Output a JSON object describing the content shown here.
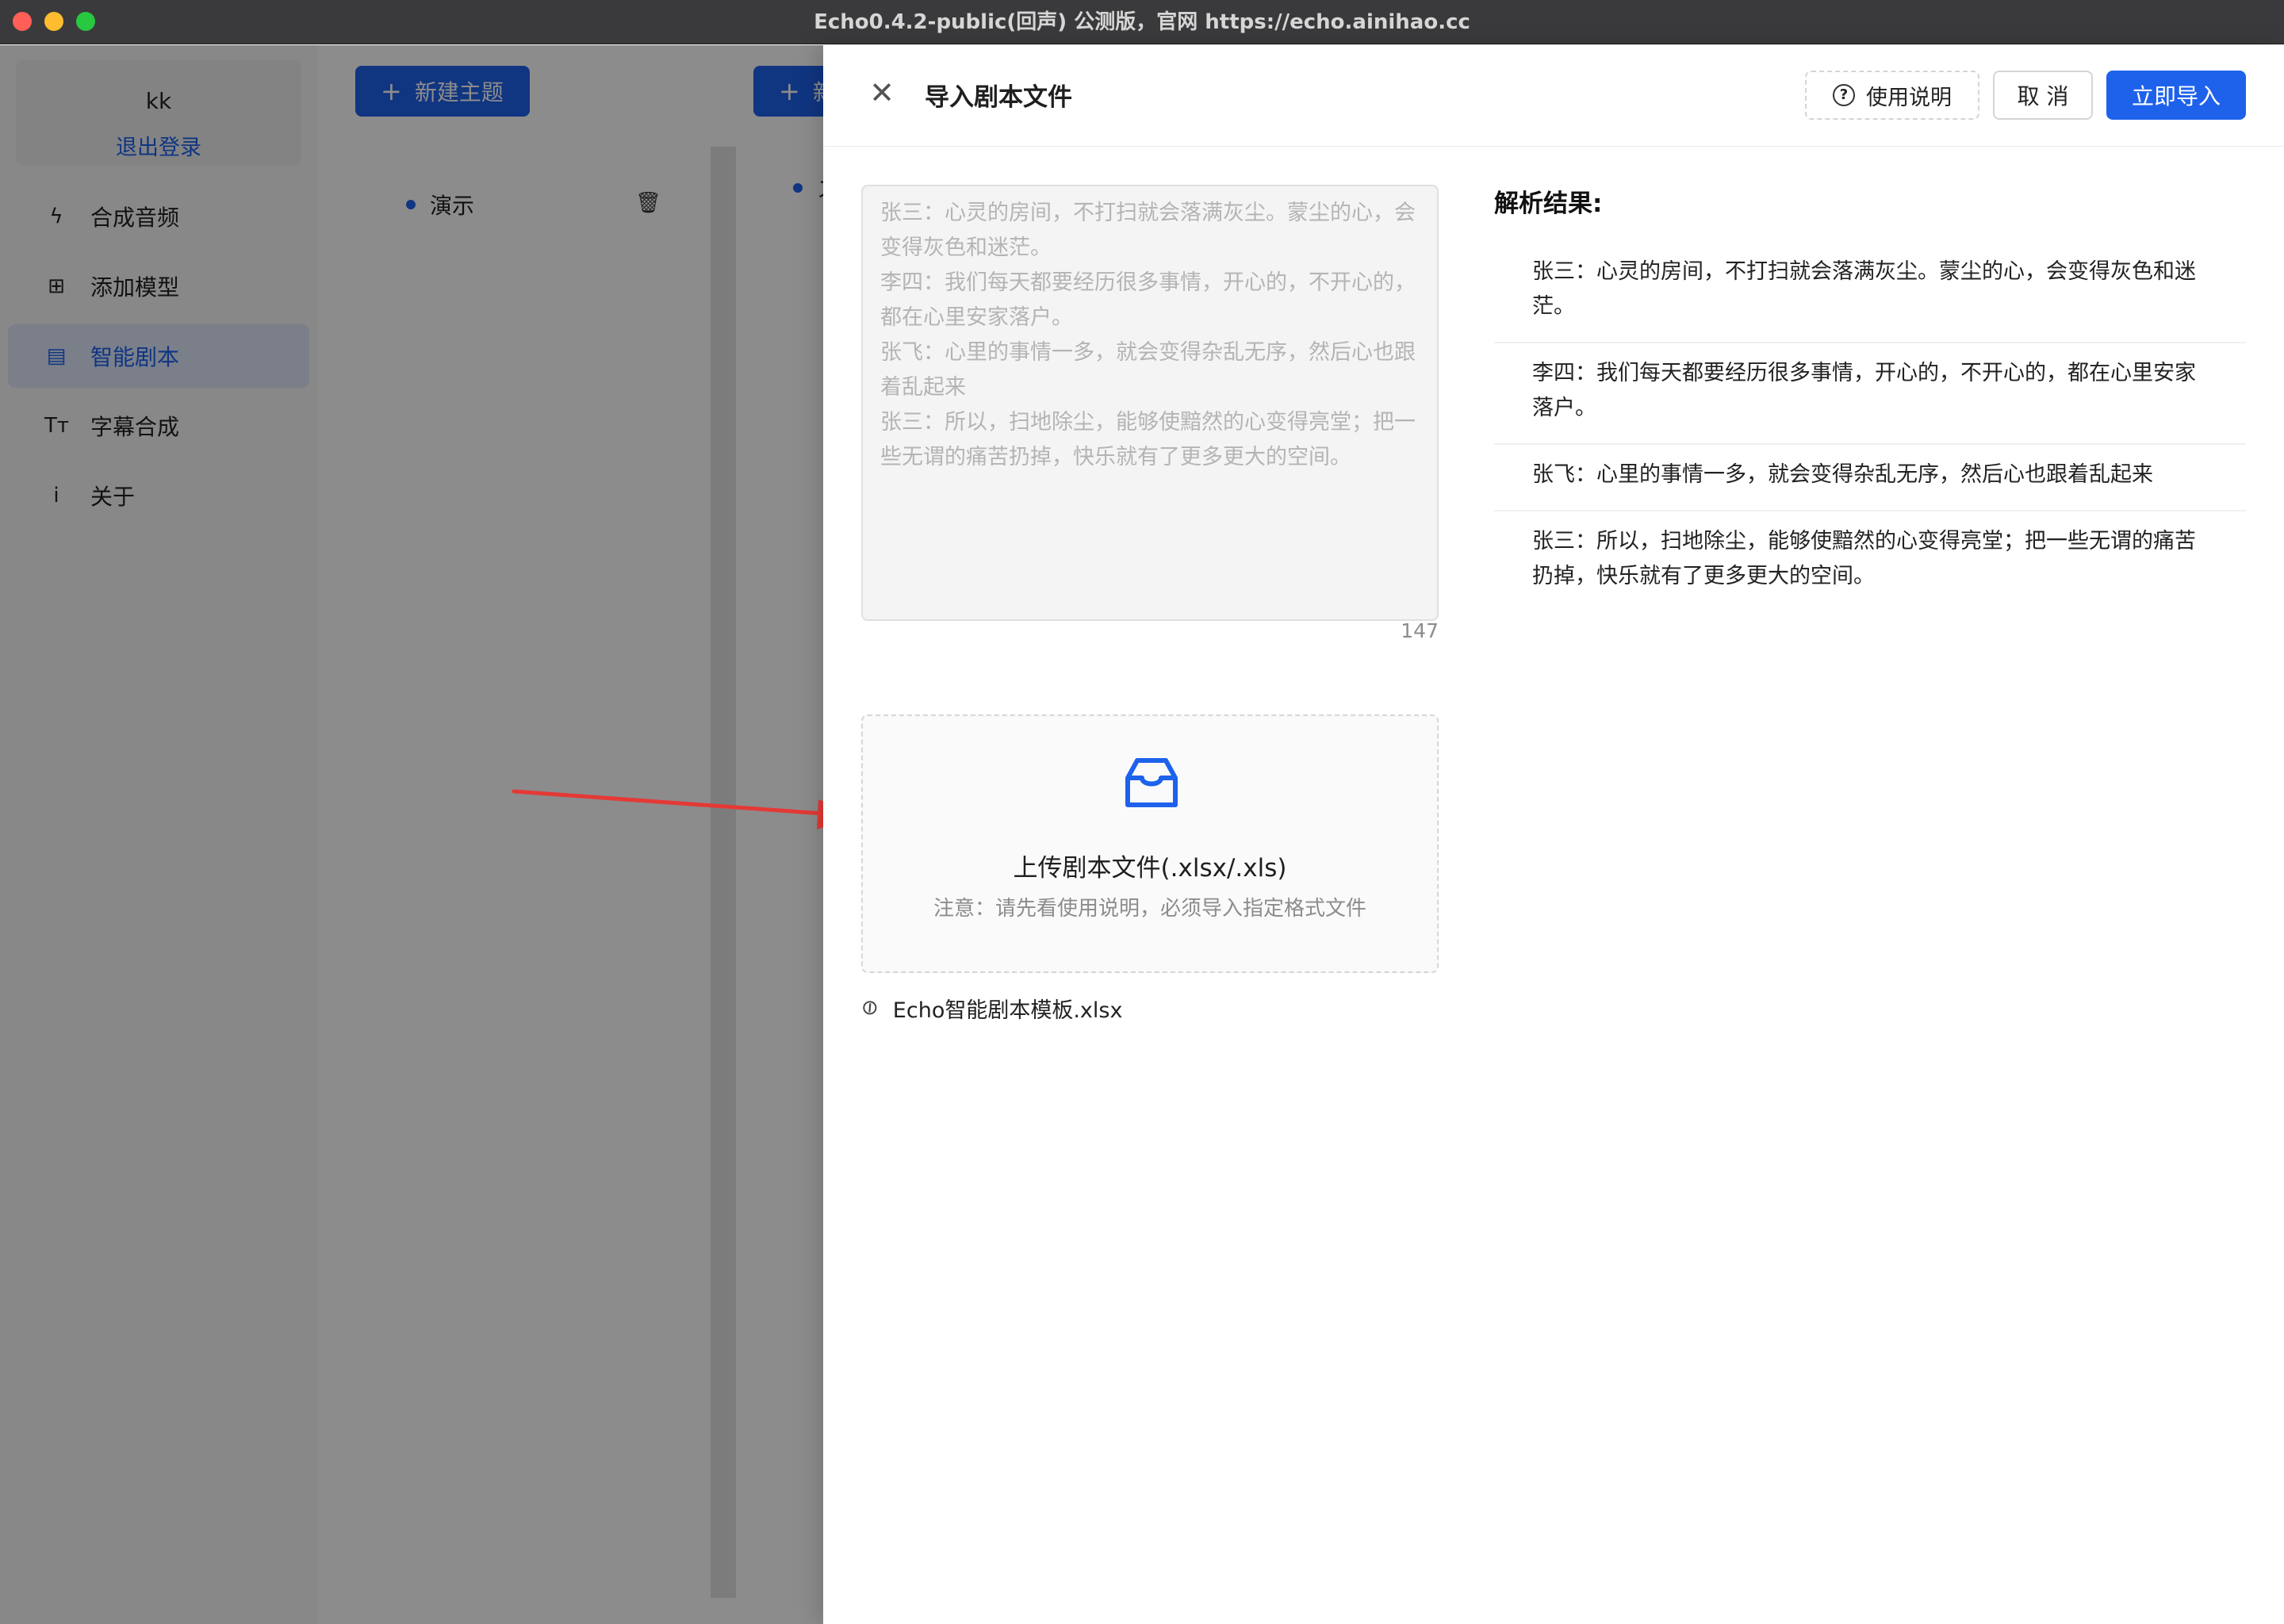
{
  "window": {
    "title": "Echo0.4.2-public(回声) 公测版，官网 https://echo.ainihao.cc"
  },
  "sidebar": {
    "user_name": "kk",
    "logout_label": "退出登录",
    "items": [
      {
        "label": "合成音频",
        "icon": "lightning-icon",
        "glyph": "ϟ",
        "active": false
      },
      {
        "label": "添加模型",
        "icon": "model-icon",
        "glyph": "⊞",
        "active": false
      },
      {
        "label": "智能剧本",
        "icon": "script-icon",
        "glyph": "▤",
        "active": true
      },
      {
        "label": "字幕合成",
        "icon": "text-size-icon",
        "glyph": "Tт",
        "active": false
      },
      {
        "label": "关于",
        "icon": "info-icon",
        "glyph": "i",
        "active": false
      }
    ]
  },
  "main": {
    "new_topic_label": "新建主题",
    "new_button_2_label": "新",
    "topics": [
      {
        "label": "演示"
      }
    ],
    "topic_2_label": "ス"
  },
  "drawer": {
    "title": "导入剧本文件",
    "help_label": "使用说明",
    "cancel_label": "取 消",
    "import_label": "立即导入",
    "textarea_value": "张三：心灵的房间，不打扫就会落满灰尘。蒙尘的心，会变得灰色和迷茫。\n李四：我们每天都要经历很多事情，开心的，不开心的，都在心里安家落户。\n张飞：心里的事情一多，就会变得杂乱无序，然后心也跟着乱起来\n张三：所以，扫地除尘，能够使黯然的心变得亮堂；把一些无谓的痛苦扔掉，快乐就有了更多更大的空间。",
    "char_count": "147",
    "upload": {
      "title": "上传剧本文件(.xlsx/.xls)",
      "hint": "注意：请先看使用说明，必须导入指定格式文件"
    },
    "attached_file": "Echo智能剧本模板.xlsx",
    "result_title": "解析结果:",
    "results": [
      {
        "text": "张三：心灵的房间，不打扫就会落满灰尘。蒙尘的心，会变得灰色和迷茫。"
      },
      {
        "text": "李四：我们每天都要经历很多事情，开心的，不开心的，都在心里安家落户。"
      },
      {
        "text": "张飞：心里的事情一多，就会变得杂乱无序，然后心也跟着乱起来"
      },
      {
        "text": "张三：所以，扫地除尘，能够使黯然的心变得亮堂；把一些无谓的痛苦扔掉，快乐就有了更多更大的空间。"
      }
    ]
  },
  "colors": {
    "primary": "#1e62ec",
    "annotation_arrow": "#e53935"
  }
}
